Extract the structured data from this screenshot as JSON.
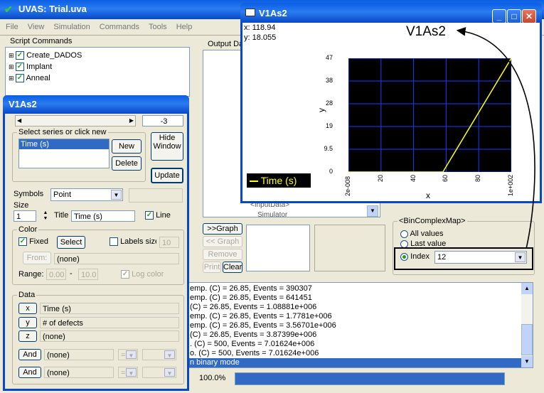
{
  "main": {
    "title": "UVAS: Trial.uva",
    "menu": [
      "File",
      "View",
      "Simulation",
      "Commands",
      "Tools",
      "Help"
    ],
    "script_commands_label": "Script Commands",
    "commands": [
      "Create_DADOS",
      "Implant",
      "Anneal"
    ],
    "output_label": "Output Da",
    "tree_partial": [
      "<InputData>",
      "Simulator"
    ],
    "graph_btn": ">>Graph",
    "ungraph_btn": "<< Graph",
    "remove_btn": "Remove",
    "print_btn": "Print",
    "clear_btn": "Clear",
    "bincomplex": {
      "label": "<BinComplexMap>",
      "all": "All values",
      "last": "Last value",
      "index": "Index",
      "index_value": "12"
    },
    "log": [
      "emp. (C) = 26.85, Events = 390307",
      "emp. (C) = 26.85, Events = 641451",
      "(C) = 26.85, Events = 1.08881e+006",
      "emp. (C) = 26.85, Events = 1.7781e+006",
      "emp. (C) = 26.85, Events = 3.56701e+006",
      "(C) = 26.85, Events = 3.87399e+006",
      ". (C) = 500, Events = 7.01624e+006",
      "o. (C) = 500, Events = 7.01624e+006",
      "n binary mode"
    ],
    "zoom": "100.0%"
  },
  "panel": {
    "title": "V1As2",
    "scroll_value": "-3",
    "series_label": "Select series or click new",
    "series_item": "Time (s)",
    "new_btn": "New",
    "delete_btn": "Delete",
    "hide_btn": "Hide Window",
    "update_btn": "Update",
    "symbols_label": "Symbols",
    "symbols_value": "Point",
    "size_label": "Size",
    "size_value": "1",
    "title_label": "Title",
    "title_value": "Time (s)",
    "line_label": "Line",
    "color_label": "Color",
    "fixed_label": "Fixed",
    "select_btn": "Select",
    "labels_label": "Labels size",
    "labels_value": "10",
    "from_btn": "From:",
    "from_value": "(none)",
    "range_label": "Range:",
    "range_min": "0.00",
    "range_max": "10.0",
    "log_color": "Log color",
    "data_label": "Data",
    "rows": [
      {
        "btn": "x",
        "value": "Time (s)"
      },
      {
        "btn": "y",
        "value": "# of defects"
      },
      {
        "btn": "z",
        "value": "(none)"
      }
    ],
    "and_rows": [
      {
        "btn": "And",
        "value": "(none)",
        "op": "="
      },
      {
        "btn": "And",
        "value": "(none)",
        "op": "="
      }
    ]
  },
  "plot": {
    "title": "V1As2",
    "coord_x": "x: 118.94",
    "coord_y": "y: 18.055",
    "annotation": "V1As2",
    "legend": "Time (s)",
    "xlabel": "x",
    "ylabel": "y"
  },
  "chart_data": {
    "type": "line",
    "series": [
      {
        "name": "Time (s)",
        "x": [
          0,
          58,
          100
        ],
        "y": [
          0,
          0,
          47
        ],
        "color": "#ffff00"
      }
    ],
    "xlim": [
      0,
      100
    ],
    "ylim": [
      0,
      47
    ],
    "xticks": [
      "2e-008",
      "20",
      "40",
      "60",
      "80",
      "1e+002"
    ],
    "yticks": [
      "47",
      "38",
      "28",
      "19",
      "9.5",
      "0"
    ],
    "xlabel": "x",
    "ylabel": "y",
    "grid": true,
    "legend": "bottom-left"
  }
}
